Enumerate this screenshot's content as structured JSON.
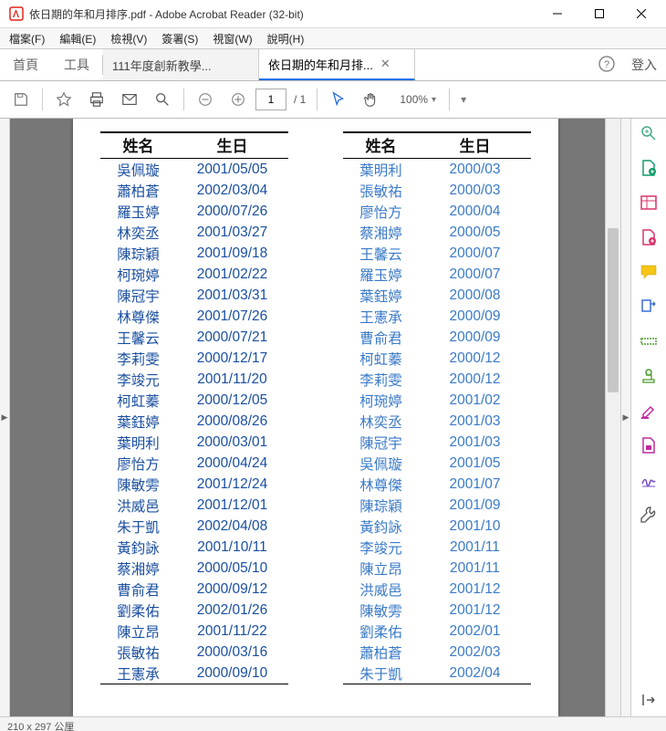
{
  "window": {
    "title": "依日期的年和月排序.pdf - Adobe Acrobat Reader (32-bit)"
  },
  "menu": {
    "file": "檔案(F)",
    "edit": "編輯(E)",
    "view": "檢視(V)",
    "sign": "簽署(S)",
    "window": "視窗(W)",
    "help": "說明(H)"
  },
  "tabs": {
    "home": "首頁",
    "tools": "工具",
    "doc1": "111年度創新教學...",
    "doc2": "依日期的年和月排...",
    "login": "登入"
  },
  "toolbar": {
    "page_current": "1",
    "page_total": "/ 1",
    "zoom": "100%"
  },
  "headers": {
    "name": "姓名",
    "bday": "生日"
  },
  "left": [
    {
      "n": "吳佩璇",
      "d": "2001/05/05"
    },
    {
      "n": "蕭柏蒼",
      "d": "2002/03/04"
    },
    {
      "n": "羅玉婷",
      "d": "2000/07/26"
    },
    {
      "n": "林奕丞",
      "d": "2001/03/27"
    },
    {
      "n": "陳琮穎",
      "d": "2001/09/18"
    },
    {
      "n": "柯琬婷",
      "d": "2001/02/22"
    },
    {
      "n": "陳冠宇",
      "d": "2001/03/31"
    },
    {
      "n": "林尊傑",
      "d": "2001/07/26"
    },
    {
      "n": "王馨云",
      "d": "2000/07/21"
    },
    {
      "n": "李莉雯",
      "d": "2000/12/17"
    },
    {
      "n": "李竣元",
      "d": "2001/11/20"
    },
    {
      "n": "柯虹蓁",
      "d": "2000/12/05"
    },
    {
      "n": "葉鈺婷",
      "d": "2000/08/26"
    },
    {
      "n": "葉明利",
      "d": "2000/03/01"
    },
    {
      "n": "廖怡方",
      "d": "2000/04/24"
    },
    {
      "n": "陳敏雱",
      "d": "2001/12/24"
    },
    {
      "n": "洪威邑",
      "d": "2001/12/01"
    },
    {
      "n": "朱于凱",
      "d": "2002/04/08"
    },
    {
      "n": "黃鈞詠",
      "d": "2001/10/11"
    },
    {
      "n": "蔡湘婷",
      "d": "2000/05/10"
    },
    {
      "n": "曹俞君",
      "d": "2000/09/12"
    },
    {
      "n": "劉柔佑",
      "d": "2002/01/26"
    },
    {
      "n": "陳立昂",
      "d": "2001/11/22"
    },
    {
      "n": "張敏祐",
      "d": "2000/03/16"
    },
    {
      "n": "王憲承",
      "d": "2000/09/10"
    }
  ],
  "right": [
    {
      "n": "葉明利",
      "d": "2000/03"
    },
    {
      "n": "張敏祐",
      "d": "2000/03"
    },
    {
      "n": "廖怡方",
      "d": "2000/04"
    },
    {
      "n": "蔡湘婷",
      "d": "2000/05"
    },
    {
      "n": "王馨云",
      "d": "2000/07"
    },
    {
      "n": "羅玉婷",
      "d": "2000/07"
    },
    {
      "n": "葉鈺婷",
      "d": "2000/08"
    },
    {
      "n": "王憲承",
      "d": "2000/09"
    },
    {
      "n": "曹俞君",
      "d": "2000/09"
    },
    {
      "n": "柯虹蓁",
      "d": "2000/12"
    },
    {
      "n": "李莉雯",
      "d": "2000/12"
    },
    {
      "n": "柯琬婷",
      "d": "2001/02"
    },
    {
      "n": "林奕丞",
      "d": "2001/03"
    },
    {
      "n": "陳冠宇",
      "d": "2001/03"
    },
    {
      "n": "吳佩璇",
      "d": "2001/05"
    },
    {
      "n": "林尊傑",
      "d": "2001/07"
    },
    {
      "n": "陳琮穎",
      "d": "2001/09"
    },
    {
      "n": "黃鈞詠",
      "d": "2001/10"
    },
    {
      "n": "李竣元",
      "d": "2001/11"
    },
    {
      "n": "陳立昂",
      "d": "2001/11"
    },
    {
      "n": "洪威邑",
      "d": "2001/12"
    },
    {
      "n": "陳敏雱",
      "d": "2001/12"
    },
    {
      "n": "劉柔佑",
      "d": "2002/01"
    },
    {
      "n": "蕭柏蒼",
      "d": "2002/03"
    },
    {
      "n": "朱于凱",
      "d": "2002/04"
    }
  ],
  "status": {
    "dims": "210 x 297 公厘"
  }
}
